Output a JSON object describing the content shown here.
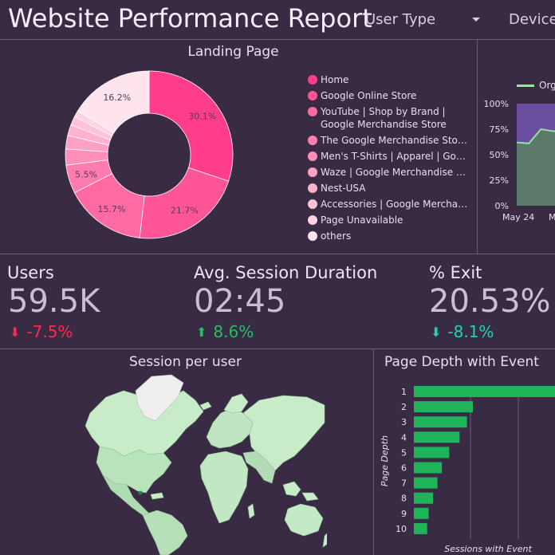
{
  "header": {
    "title": "Website Performance Report",
    "filter_user_type": "User Type",
    "filter_device": "Device"
  },
  "landing_page": {
    "title": "Landing Page",
    "legend": [
      {
        "label": "Home",
        "color": "#ff3d8a"
      },
      {
        "label": "Google Online Store",
        "color": "#ff5596"
      },
      {
        "label": "YouTube | Shop by Brand | Google Merchandise Store",
        "color": "#ff6aa2"
      },
      {
        "label": "The Google Merchandise Store -...",
        "color": "#ff7dae"
      },
      {
        "label": "Men's T-Shirts | Apparel | Google...",
        "color": "#ff8fb9"
      },
      {
        "label": "Waze | Google Merchandise Store",
        "color": "#ffa0c4"
      },
      {
        "label": "Nest-USA",
        "color": "#ffb1cf"
      },
      {
        "label": "Accessories | Google Merchandis...",
        "color": "#ffc2d9"
      },
      {
        "label": "Page Unavailable",
        "color": "#ffd3e4"
      },
      {
        "label": "others",
        "color": "#ffe4ee"
      }
    ]
  },
  "timeline": {
    "legend_label": "Org",
    "y_ticks": [
      "100%",
      "75%",
      "50%",
      "25%",
      "0%"
    ],
    "x_ticks": [
      "May 24",
      "M"
    ]
  },
  "kpis": [
    {
      "label": "Users",
      "value": "59.5K",
      "delta": "-7.5%",
      "arrow": "down",
      "color": "#ff2a4a"
    },
    {
      "label": "Avg. Session Duration",
      "value": "02:45",
      "delta": "8.6%",
      "arrow": "up",
      "color": "#21c064"
    },
    {
      "label": "% Exit",
      "value": "20.53%",
      "delta": "-8.1%",
      "arrow": "down",
      "color": "#1ed2b4"
    }
  ],
  "map": {
    "title": "Session per user"
  },
  "page_depth": {
    "title": "Page Depth with Event",
    "ylabel": "Page Depth",
    "xlabel": "Sessions with Event"
  },
  "chart_data": [
    {
      "type": "pie",
      "title": "Landing Page",
      "categories": [
        "Home",
        "Google Online Store",
        "YouTube | Shop by Brand | Google Merchandise Store",
        "The Google Merchandise Store -...",
        "Men's T-Shirts | Apparel | Google...",
        "Waze | Google Merchandise Store",
        "Nest-USA",
        "Accessories | Google Merchandis...",
        "Page Unavailable",
        "others"
      ],
      "values": [
        30.1,
        21.7,
        15.7,
        5.5,
        3.1,
        2.6,
        2.1,
        1.7,
        1.3,
        16.2
      ],
      "labels": [
        "30.1%",
        "21.7%",
        "15.7%",
        "5.5%",
        "",
        "",
        "",
        "",
        "",
        "16.2%"
      ]
    },
    {
      "type": "area",
      "series": [
        {
          "name": "Org",
          "values": [
            62,
            61,
            75,
            73
          ]
        }
      ],
      "ylim": [
        0,
        100
      ]
    },
    {
      "type": "bar",
      "title": "Page Depth with Event",
      "categories": [
        "1",
        "2",
        "3",
        "4",
        "5",
        "6",
        "7",
        "8",
        "9",
        "10"
      ],
      "values": [
        100,
        40,
        36,
        31,
        24,
        19,
        16,
        13,
        10,
        9
      ],
      "xlabel": "Sessions with Event",
      "ylabel": "Page Depth"
    }
  ]
}
